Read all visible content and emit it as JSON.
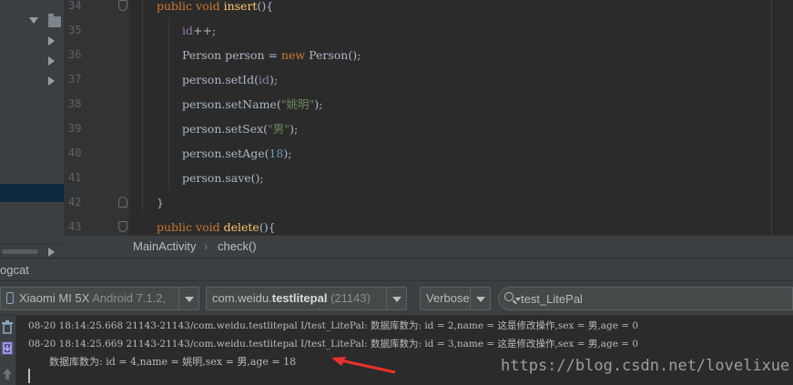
{
  "editor": {
    "lines": [
      {
        "num": "34",
        "tokens": [
          {
            "t": "public void ",
            "c": "kw"
          },
          {
            "t": "insert",
            "c": "fn"
          },
          {
            "t": "(){",
            "c": ""
          }
        ],
        "indent": 1
      },
      {
        "num": "35",
        "tokens": [
          {
            "t": "id",
            "c": "fld"
          },
          {
            "t": "++;",
            "c": ""
          }
        ],
        "indent": 2
      },
      {
        "num": "36",
        "tokens": [
          {
            "t": "Person person = ",
            "c": ""
          },
          {
            "t": "new ",
            "c": "kw"
          },
          {
            "t": "Person();",
            "c": ""
          }
        ],
        "indent": 2
      },
      {
        "num": "37",
        "tokens": [
          {
            "t": "person.setId(",
            "c": ""
          },
          {
            "t": "id",
            "c": "fld"
          },
          {
            "t": ");",
            "c": ""
          }
        ],
        "indent": 2
      },
      {
        "num": "38",
        "tokens": [
          {
            "t": "person.setName(",
            "c": ""
          },
          {
            "t": "\"姚明\"",
            "c": "str"
          },
          {
            "t": ");",
            "c": ""
          }
        ],
        "indent": 2
      },
      {
        "num": "39",
        "tokens": [
          {
            "t": "person.setSex(",
            "c": ""
          },
          {
            "t": "\"男\"",
            "c": "str"
          },
          {
            "t": ");",
            "c": ""
          }
        ],
        "indent": 2
      },
      {
        "num": "40",
        "tokens": [
          {
            "t": "person.setAge(",
            "c": ""
          },
          {
            "t": "18",
            "c": "num"
          },
          {
            "t": ");",
            "c": ""
          }
        ],
        "indent": 2
      },
      {
        "num": "41",
        "tokens": [
          {
            "t": "person.save();",
            "c": ""
          }
        ],
        "indent": 2
      },
      {
        "num": "42",
        "tokens": [
          {
            "t": "}",
            "c": ""
          }
        ],
        "indent": 1
      },
      {
        "num": "43",
        "tokens": [
          {
            "t": "public void ",
            "c": "kw"
          },
          {
            "t": "delete",
            "c": "fn"
          },
          {
            "t": "(){",
            "c": ""
          }
        ],
        "indent": 1
      }
    ]
  },
  "breadcrumb": {
    "class_name": "MainActivity",
    "method_name": "check()"
  },
  "logcat": {
    "title": "ogcat",
    "device": {
      "name": "Xiaomi MI 5X",
      "detail": "Android 7.1.2,"
    },
    "process": {
      "prefix": "com.weidu.",
      "bold": "testlitepal",
      "pid": "(21143)"
    },
    "level": "Verbose",
    "search_value": "test_LitePal",
    "lines": [
      "08-20 18:14:25.668 21143-21143/com.weidu.testlitepal I/test_LitePal: 数据库数为: id = 2,name = 这是修改操作,sex = 男,age = 0",
      "08-20 18:14:25.669 21143-21143/com.weidu.testlitepal I/test_LitePal: 数据库数为: id = 3,name = 这是修改操作,sex = 男,age = 0",
      "数据库数为: id = 4,name = 姚明,sex = 男,age = 18"
    ]
  },
  "watermark": "https://blog.csdn.net/lovelixue",
  "colors": {
    "annotation_arrow": "#e8322c",
    "accent_selection": "#0d293e"
  }
}
